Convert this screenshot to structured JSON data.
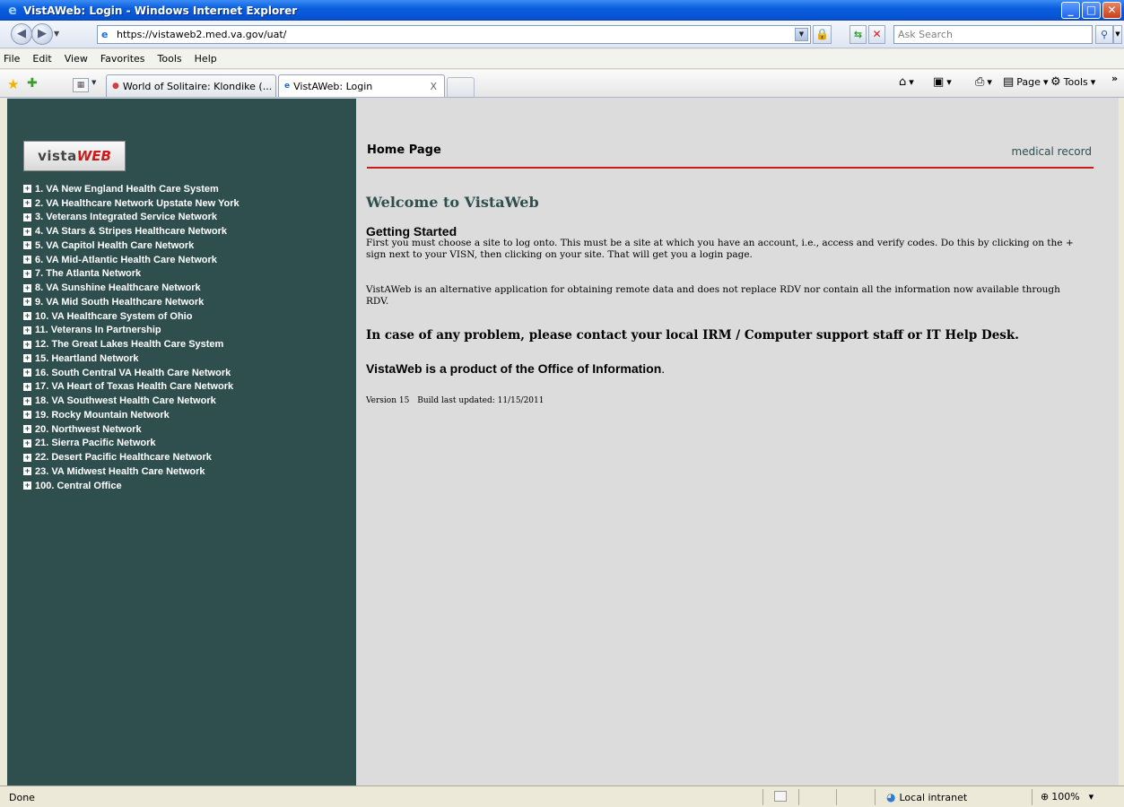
{
  "window": {
    "title": "VistAWeb: Login - Windows Internet Explorer",
    "controls": [
      "minimize",
      "maximize",
      "close"
    ]
  },
  "address_bar": {
    "url": "https://vistaweb2.med.va.gov/uat/",
    "search_placeholder": "Ask Search"
  },
  "menu": [
    "File",
    "Edit",
    "View",
    "Favorites",
    "Tools",
    "Help"
  ],
  "tabs": [
    {
      "label": "World of Solitaire: Klondike (...",
      "active": false
    },
    {
      "label": "VistAWeb: Login",
      "active": true,
      "close": "X"
    }
  ],
  "command_bar": {
    "page_label": "Page",
    "tools_label": "Tools",
    "overflow": "»"
  },
  "sidebar": {
    "logo_text_a": "vista",
    "logo_text_b": "WEB",
    "plus_glyph": "+",
    "visn_items": [
      "1. VA New England Health Care System",
      "2. VA Healthcare Network Upstate New York",
      "3. Veterans Integrated Service Network",
      "4. VA Stars & Stripes Healthcare Network",
      "5. VA Capitol Health Care Network",
      "6. VA Mid-Atlantic Health Care Network",
      "7. The Atlanta Network",
      "8. VA Sunshine Healthcare Network",
      "9. VA Mid South Healthcare Network",
      "10. VA Healthcare System of Ohio",
      "11. Veterans In Partnership",
      "12. The Great Lakes Health Care System",
      "15. Heartland Network",
      "16. South Central VA Health Care Network",
      "17. VA Heart of Texas Health Care Network",
      "18. VA Southwest Health Care Network",
      "19. Rocky Mountain Network",
      "20. Northwest Network",
      "21. Sierra Pacific Network",
      "22. Desert Pacific Healthcare Network",
      "23. VA Midwest Health Care Network",
      "100. Central Office"
    ]
  },
  "main": {
    "header_title": "Home Page",
    "header_right": "medical record",
    "welcome": "Welcome to VistaWeb",
    "getting_started_title": "Getting Started",
    "getting_started_body": "First you must choose a site to log onto. This must be a site at which you have an account, i.e., access and verify codes. Do this by clicking on the + sign next to your VISN, then clicking on your site. That will get you a login page.",
    "alternative_body": "VistAWeb is an alternative application for obtaining remote data and does not replace RDV nor contain all the information now available through RDV.",
    "contact": "In case of any problem, please contact your local IRM / Computer support staff or IT Help Desk.",
    "product_text": "VistaWeb is a product of the Office of Information",
    "product_end": ".",
    "version": "Version 15",
    "build": "Build last updated: 11/15/2011"
  },
  "status_bar": {
    "status": "Done",
    "zone": "Local intranet",
    "zoom": "100%"
  },
  "colors": {
    "sidebar_bg": "#2f4f4f",
    "content_bg": "#dcdcdc",
    "accent_red": "#cc1b1b",
    "title_bar": "#0a5fde"
  }
}
